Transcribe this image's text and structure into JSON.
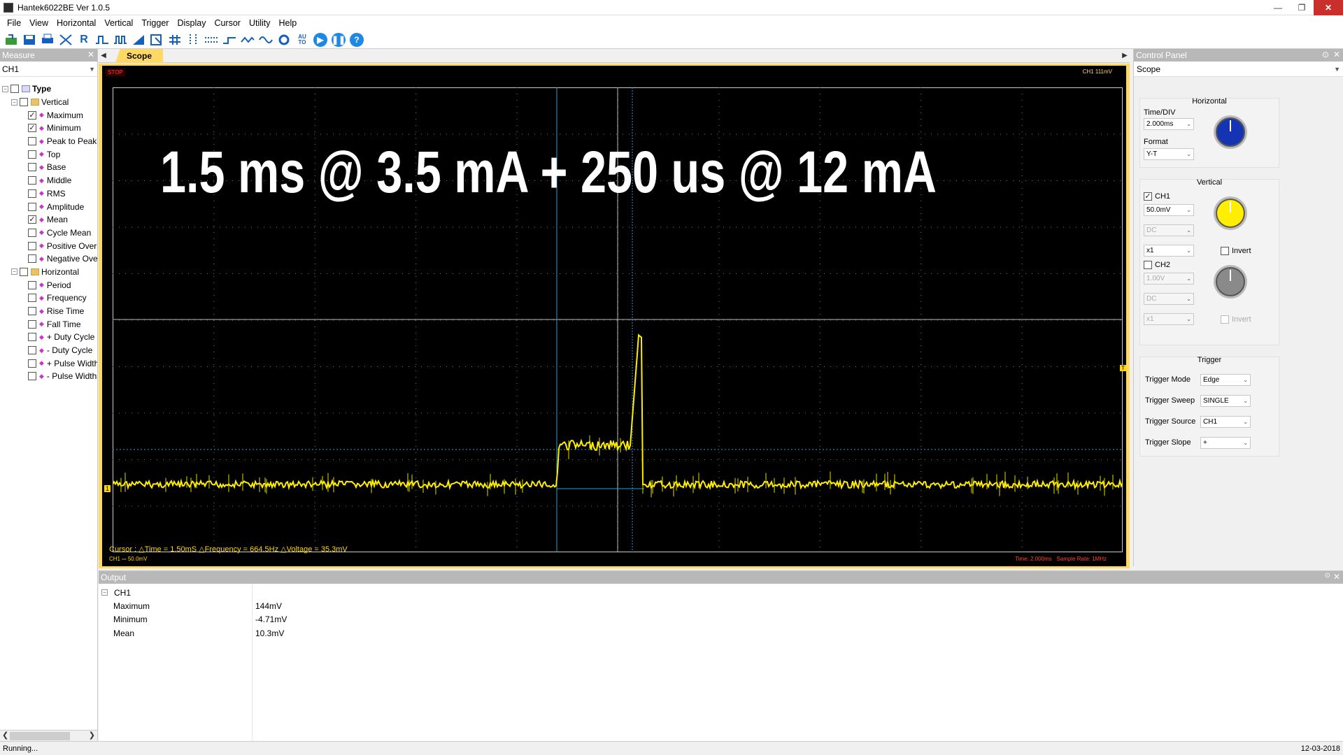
{
  "window": {
    "title": "Hantek6022BE Ver 1.0.5"
  },
  "menu": [
    "File",
    "View",
    "Horizontal",
    "Vertical",
    "Trigger",
    "Display",
    "Cursor",
    "Utility",
    "Help"
  ],
  "toolbar": {
    "auto_label": "AU\nTO",
    "run_icon": "play-icon",
    "pause_icon": "pause-icon",
    "help_label": "?"
  },
  "measure": {
    "title": "Measure",
    "channel": "CH1",
    "root": "Type",
    "vertical_group": "Vertical",
    "horizontal_group": "Horizontal",
    "vertical_items": [
      {
        "label": "Maximum",
        "checked": true
      },
      {
        "label": "Minimum",
        "checked": true
      },
      {
        "label": "Peak to Peak",
        "checked": false
      },
      {
        "label": "Top",
        "checked": false
      },
      {
        "label": "Base",
        "checked": false
      },
      {
        "label": "Middle",
        "checked": false
      },
      {
        "label": "RMS",
        "checked": false
      },
      {
        "label": "Amplitude",
        "checked": false
      },
      {
        "label": "Mean",
        "checked": true
      },
      {
        "label": "Cycle Mean",
        "checked": false
      },
      {
        "label": "Positive Overs",
        "checked": false
      },
      {
        "label": "Negative Ove",
        "checked": false
      }
    ],
    "horizontal_items": [
      {
        "label": "Period",
        "checked": false
      },
      {
        "label": "Frequency",
        "checked": false
      },
      {
        "label": "Rise Time",
        "checked": false
      },
      {
        "label": "Fall Time",
        "checked": false
      },
      {
        "label": "+ Duty Cycle",
        "checked": false
      },
      {
        "label": "- Duty Cycle",
        "checked": false
      },
      {
        "label": "+ Pulse Width",
        "checked": false
      },
      {
        "label": "- Pulse Width",
        "checked": false
      }
    ]
  },
  "scope": {
    "tab": "Scope",
    "stop_label": "STOP",
    "trigger_readout": "CH1 111mV",
    "annotation": "1.5 ms @ 3.5 mA + 250 us @ 12 mA",
    "cursor_info": "Cursor : △Time = 1.50mS  △Frequency = 664.5Hz  △Voltage = 35.3mV",
    "ch_status": "CH1 ⎓   50.0mV",
    "time_status": "Time: 2.000ms",
    "rate_status": "Sample Rate: 1MHz"
  },
  "control": {
    "title": "Control Panel",
    "mode": "Scope",
    "horizontal": {
      "title": "Horizontal",
      "timediv_label": "Time/DIV",
      "timediv": "2.000ms",
      "format_label": "Format",
      "format": "Y-T"
    },
    "vertical": {
      "title": "Vertical",
      "ch1": {
        "label": "CH1",
        "enabled": true,
        "volts": "50.0mV",
        "coupling": "DC",
        "probe": "x1",
        "invert_label": "Invert"
      },
      "ch2": {
        "label": "CH2",
        "enabled": false,
        "volts": "1.00V",
        "coupling": "DC",
        "probe": "x1",
        "invert_label": "Invert"
      }
    },
    "trigger": {
      "title": "Trigger",
      "mode_label": "Trigger Mode",
      "mode": "Edge",
      "sweep_label": "Trigger Sweep",
      "sweep": "SINGLE",
      "source_label": "Trigger Source",
      "source": "CH1",
      "slope_label": "Trigger Slope",
      "slope": "+"
    },
    "colors": {
      "horizontal_knob": "#1434b4",
      "ch1_knob": "#ffee00",
      "ch2_knob": "#8a8a8a"
    }
  },
  "output": {
    "title": "Output",
    "channel": "CH1",
    "rows": [
      {
        "name": "Maximum",
        "value": "144mV"
      },
      {
        "name": "Minimum",
        "value": "-4.71mV"
      },
      {
        "name": "Mean",
        "value": "10.3mV"
      }
    ]
  },
  "statusbar": {
    "left": "Running...",
    "right": "12-03-2018"
  }
}
